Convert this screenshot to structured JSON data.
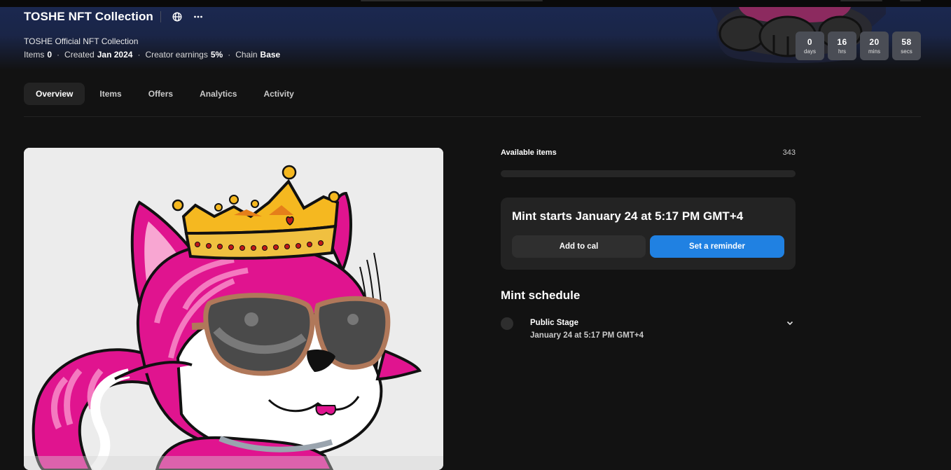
{
  "collection": {
    "title": "TOSHE NFT Collection",
    "subtitle": "TOSHE Official NFT Collection",
    "meta": [
      {
        "label": "Items",
        "value": "0"
      },
      {
        "label": "Created",
        "value": "Jan 2024"
      },
      {
        "label": "Creator earnings",
        "value": "5%"
      },
      {
        "label": "Chain",
        "value": "Base"
      }
    ],
    "icons": [
      "globe-icon",
      "more-icon"
    ]
  },
  "countdown": [
    {
      "value": "0",
      "unit": "days"
    },
    {
      "value": "16",
      "unit": "hrs"
    },
    {
      "value": "20",
      "unit": "mins"
    },
    {
      "value": "58",
      "unit": "secs"
    }
  ],
  "tabs": [
    {
      "label": "Overview",
      "active": true
    },
    {
      "label": "Items",
      "active": false
    },
    {
      "label": "Offers",
      "active": false
    },
    {
      "label": "Analytics",
      "active": false
    },
    {
      "label": "Activity",
      "active": false
    }
  ],
  "mint": {
    "available_label": "Available items",
    "available_count": "343",
    "progress_fraction": 0,
    "starts_text": "Mint starts January 24 at 5:17 PM GMT+4",
    "add_to_cal": "Add to cal",
    "set_reminder": "Set a reminder"
  },
  "schedule": {
    "title": "Mint schedule",
    "stages": [
      {
        "name": "Public Stage",
        "date": "January 24 at 5:17 PM GMT+4"
      }
    ]
  },
  "colors": {
    "background": "#121212",
    "accent": "#2081e2",
    "card": "#232323",
    "hero": "#1b2850",
    "nft_pink": "#e0148f",
    "crown_gold": "#f5b820"
  }
}
